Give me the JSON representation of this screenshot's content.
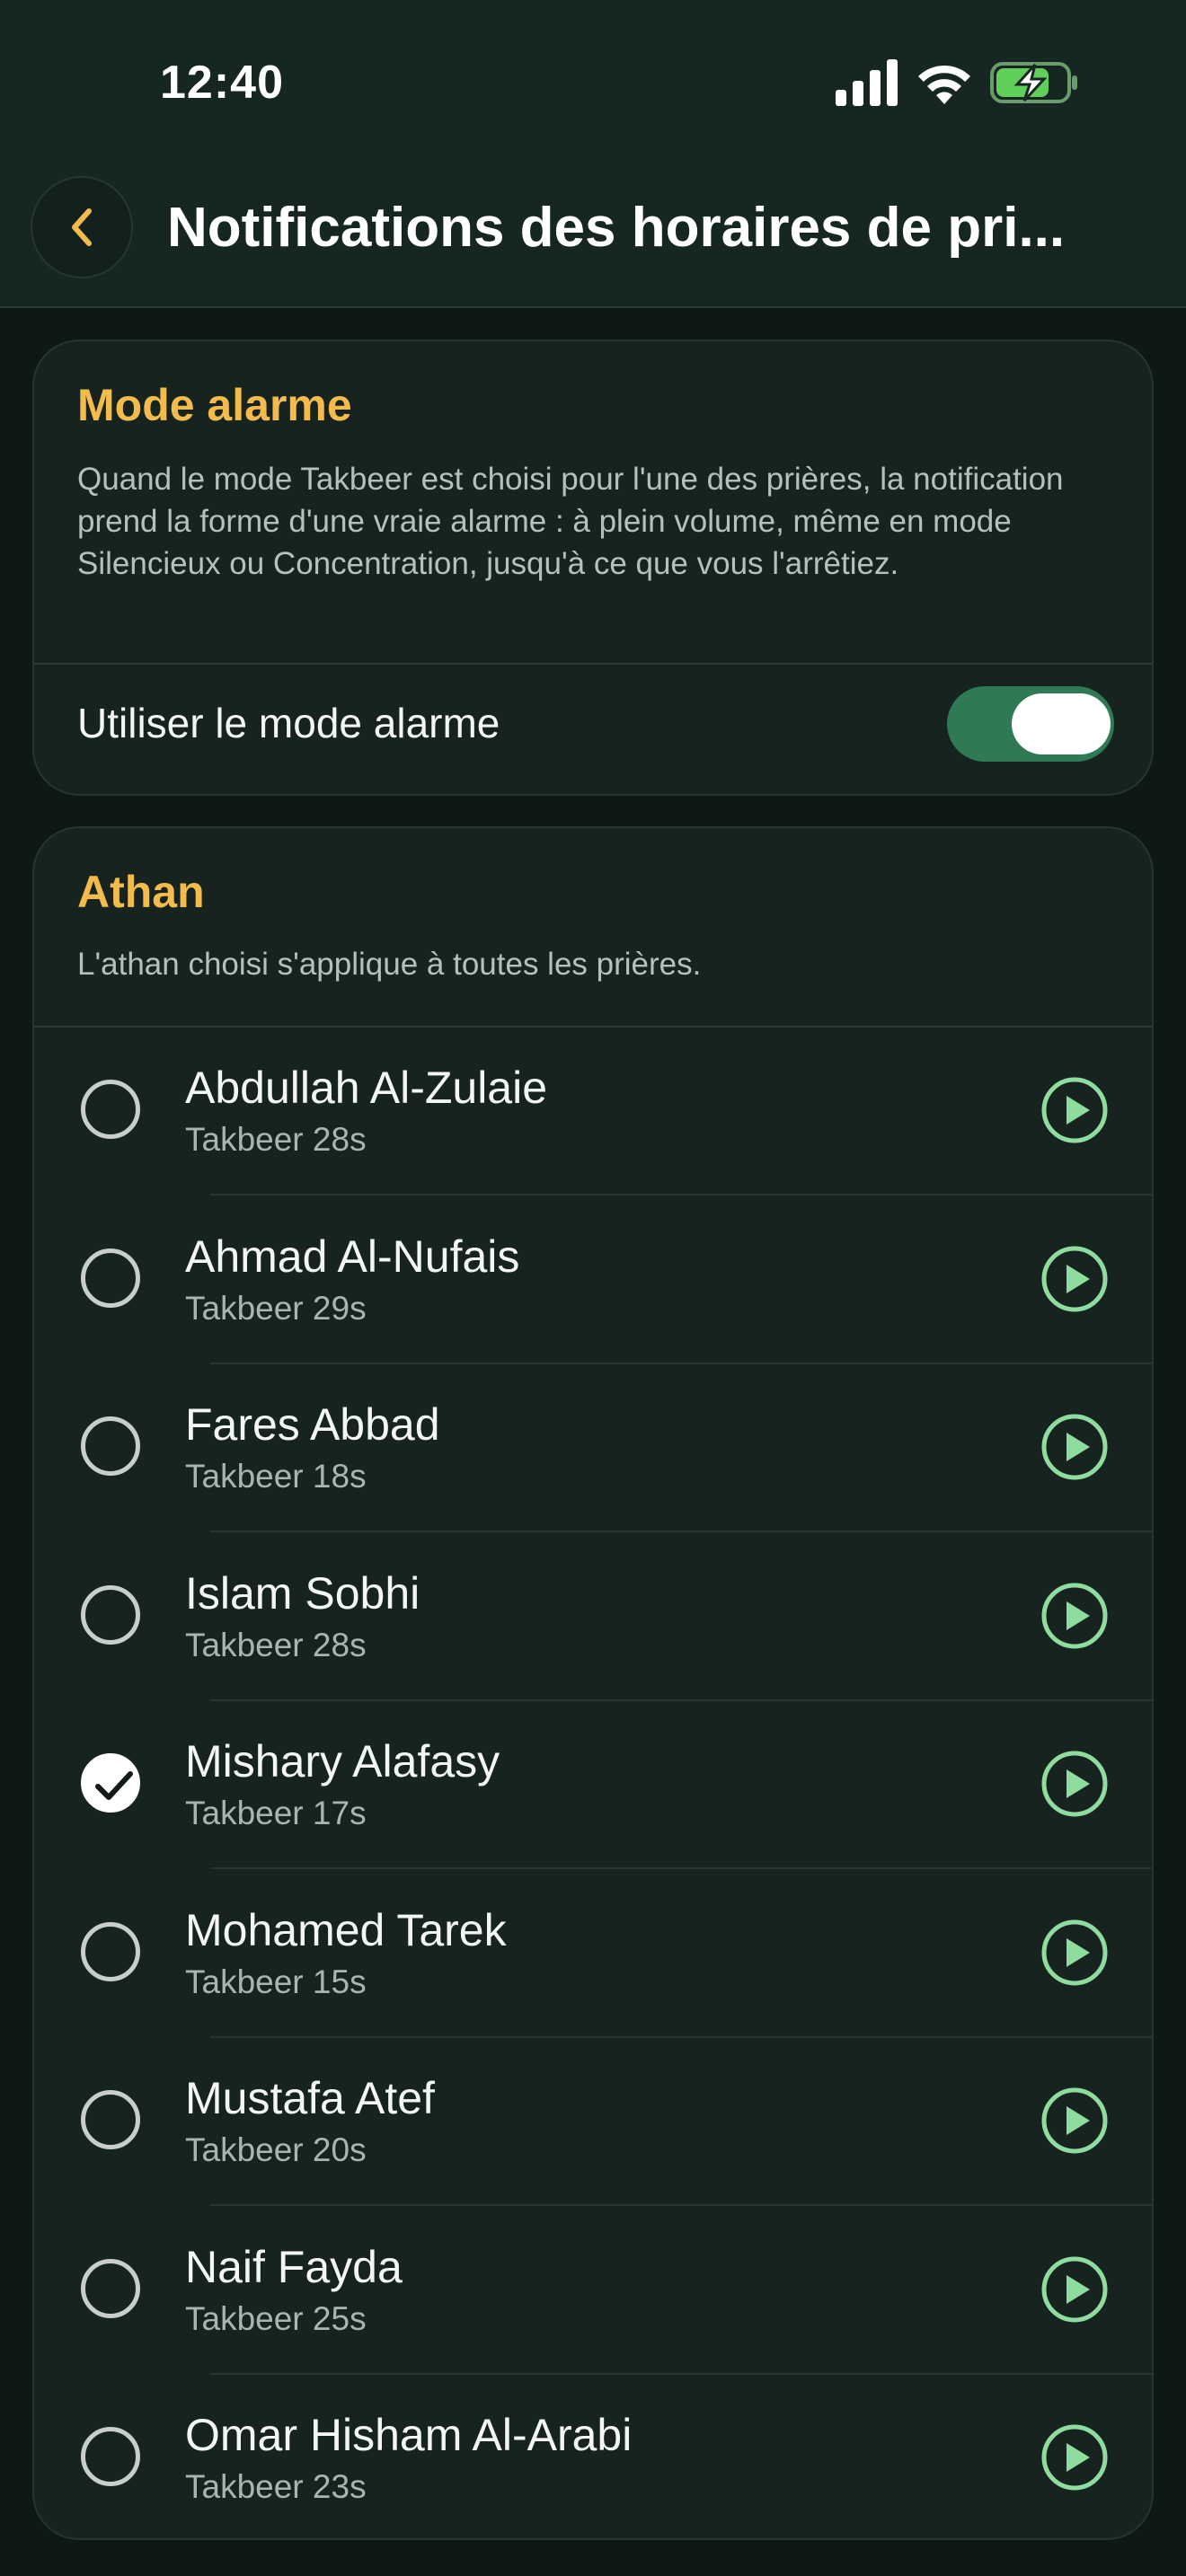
{
  "status_bar": {
    "time": "12:40"
  },
  "header": {
    "title": "Notifications des horaires de pri...",
    "back_icon": "chevron-left-icon"
  },
  "colors": {
    "accent": "#f2bb4c",
    "play": "#8fdc9f",
    "toggle_on": "#2f7a55"
  },
  "alarm": {
    "title": "Mode alarme",
    "description": "Quand le mode Takbeer est choisi pour l'une des prières, la notification prend la forme d'une vraie alarme : à plein volume, même en mode Silencieux ou Concentration, jusqu'à ce que vous l'arrêtiez.",
    "toggle_label": "Utiliser le mode alarme",
    "toggle_on": true
  },
  "athan": {
    "title": "Athan",
    "description": "L'athan choisi s'applique à toutes les prières.",
    "reciters": [
      {
        "name": "Abdullah Al-Zulaie",
        "detail": "Takbeer 28s",
        "selected": false
      },
      {
        "name": "Ahmad Al-Nufais",
        "detail": "Takbeer 29s",
        "selected": false
      },
      {
        "name": "Fares Abbad",
        "detail": "Takbeer 18s",
        "selected": false
      },
      {
        "name": "Islam Sobhi",
        "detail": "Takbeer 28s",
        "selected": false
      },
      {
        "name": "Mishary Alafasy",
        "detail": "Takbeer 17s",
        "selected": true
      },
      {
        "name": "Mohamed Tarek",
        "detail": "Takbeer 15s",
        "selected": false
      },
      {
        "name": "Mustafa Atef",
        "detail": "Takbeer 20s",
        "selected": false
      },
      {
        "name": "Naif Fayda",
        "detail": "Takbeer 25s",
        "selected": false
      },
      {
        "name": "Omar Hisham Al-Arabi",
        "detail": "Takbeer 23s",
        "selected": false
      }
    ]
  }
}
